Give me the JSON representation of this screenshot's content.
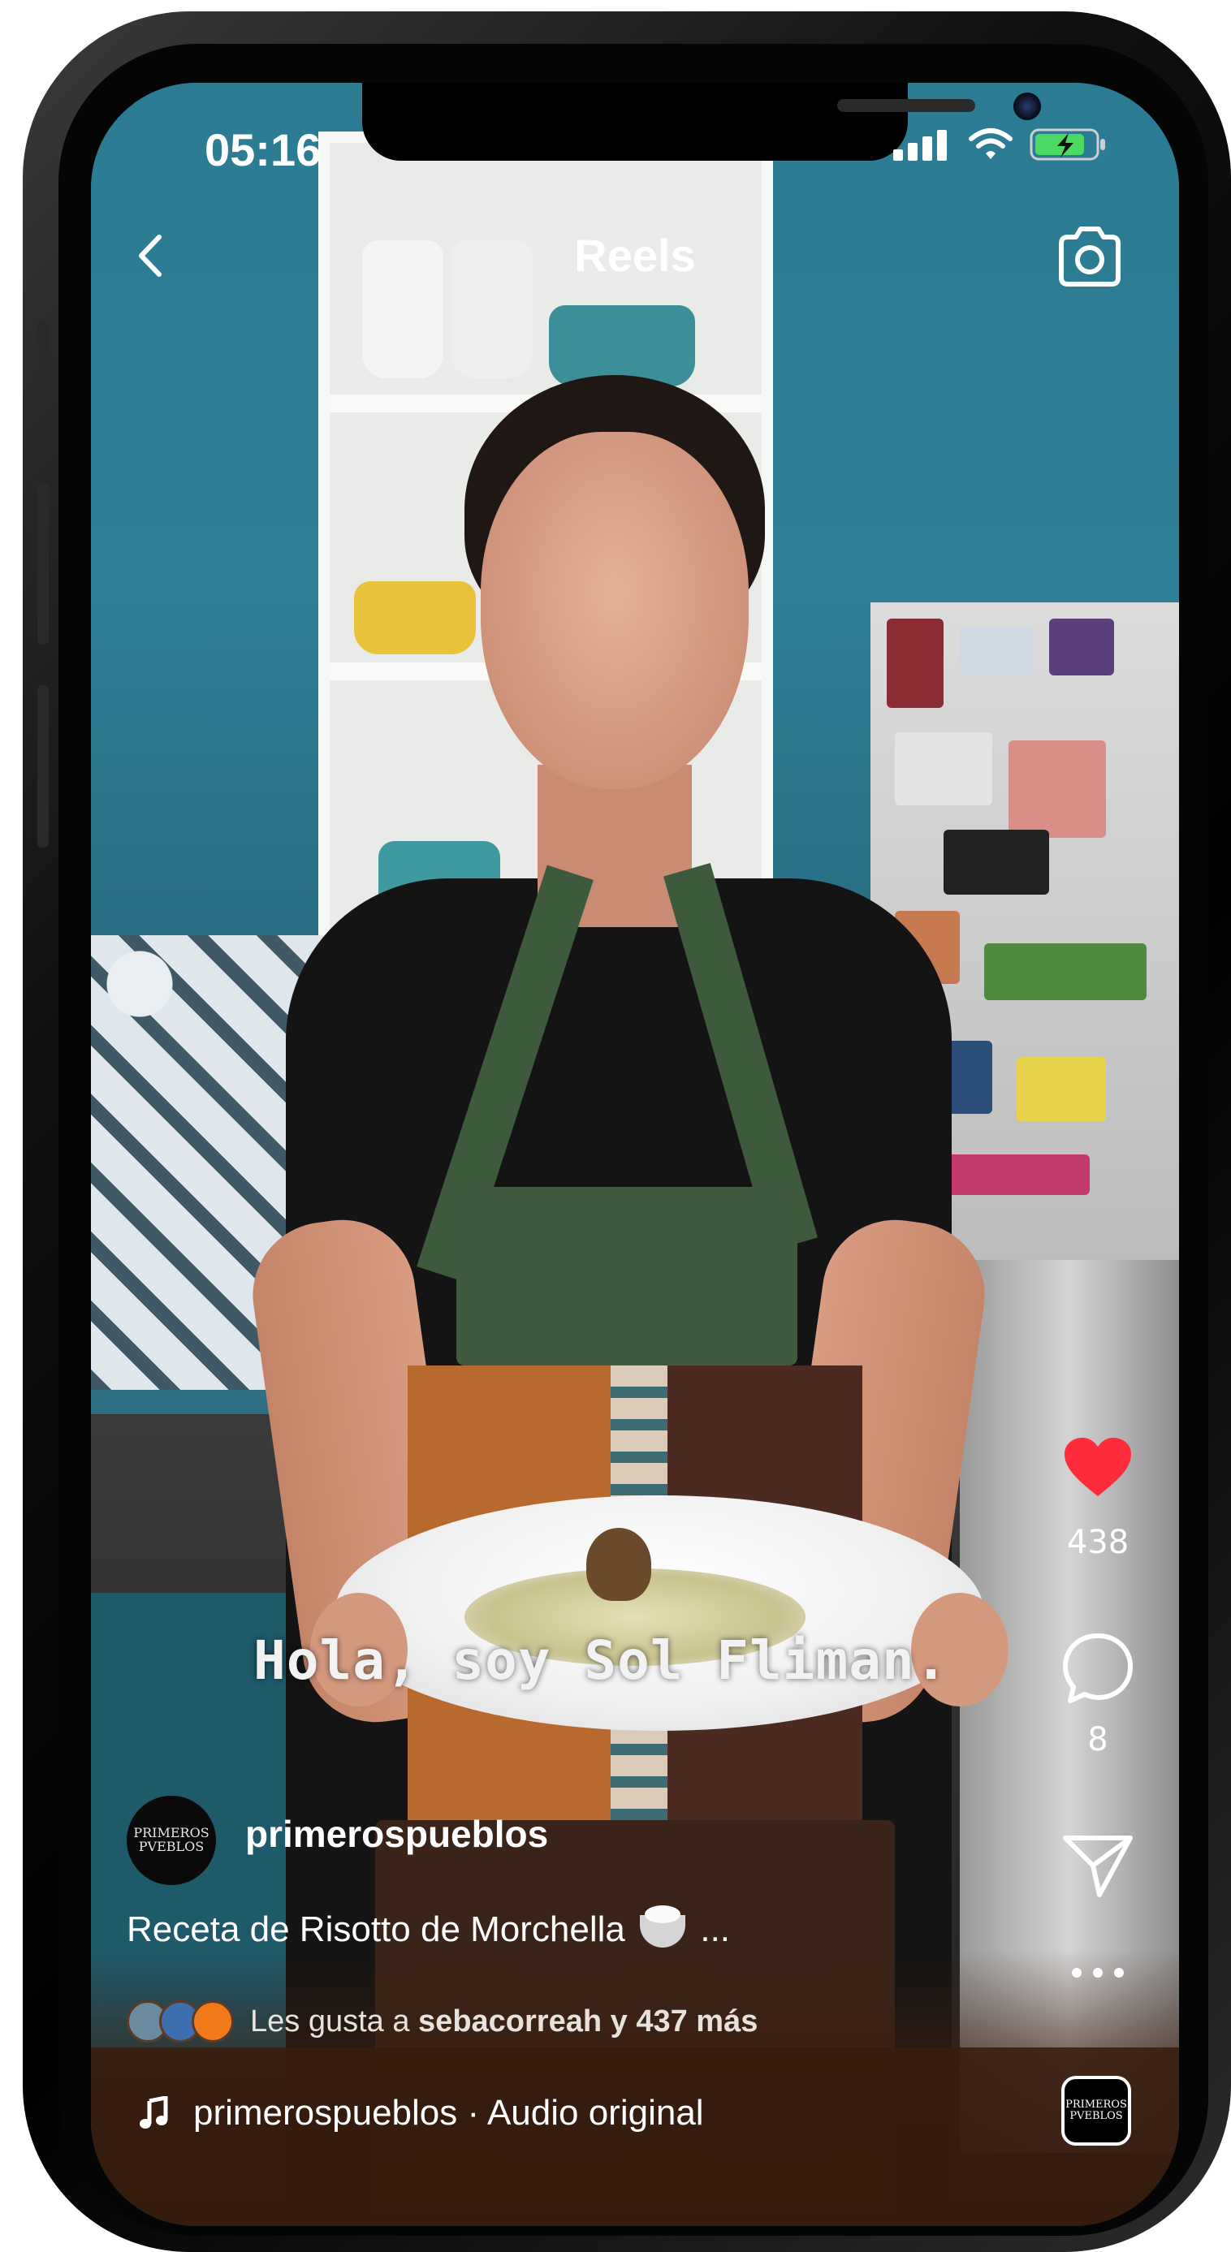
{
  "status_bar": {
    "time": "05:16"
  },
  "header": {
    "title": "Reels"
  },
  "video": {
    "caption": "Hola, soy Sol Fliman."
  },
  "actions": {
    "like_count": "438",
    "comment_count": "8"
  },
  "post": {
    "avatar_text": "PRIMEROS PVEBLOS",
    "username": "primerospueblos",
    "description": "Receta de Risotto de Morchella",
    "description_more": "...",
    "likes_prefix": "Les gusta a",
    "likes_user": "sebacorreah",
    "likes_suffix": "y 437 más"
  },
  "audio": {
    "label": "primerospueblos · Audio original",
    "thumb_text": "PRIMEROS PVEBLOS"
  },
  "colors": {
    "like_red": "#ff2d3b",
    "text": "#ffffff"
  },
  "icons": [
    "back-icon",
    "camera-icon",
    "heart-icon",
    "comment-icon",
    "share-icon",
    "more-icon",
    "music-note-icon",
    "signal-icon",
    "wifi-icon",
    "battery-icon"
  ]
}
